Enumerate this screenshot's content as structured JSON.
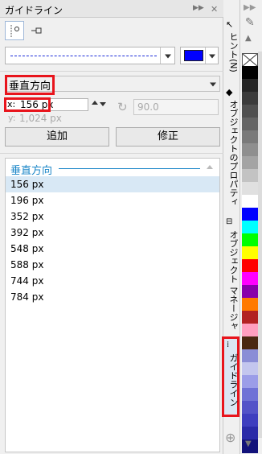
{
  "title": "ガイドライン",
  "title_help": "?",
  "color_value": "#0000ff",
  "direction_select": "垂直方向",
  "x_label": "x:",
  "x_value": "156 px",
  "y_label": "y:",
  "y_value": "1,024 px",
  "angle_value": "90.0",
  "add_button": "追加",
  "modify_button": "修正",
  "list_header": "垂直方向",
  "guides": [
    "156  px",
    "196  px",
    "352  px",
    "392  px",
    "548  px",
    "588  px",
    "744  px",
    "784  px"
  ],
  "side_tabs": {
    "hints": "ヒント(N)",
    "object_properties": "オブジェクトのプロパティ",
    "object_manager": "オブジェクト マネージャ",
    "guidelines": "ガイドライン"
  },
  "palette_colors": [
    "#ffffff",
    "#000000",
    "#252525",
    "#3b3b3b",
    "#505050",
    "#656565",
    "#7a7a7a",
    "#8f8f8f",
    "#a4a4a4",
    "#c3c3c3",
    "#e0e0e0",
    "#ffffff",
    "#0000ff",
    "#00ffff",
    "#00ff00",
    "#ffff00",
    "#ff0000",
    "#ff00ff",
    "#8800aa",
    "#ff7a00",
    "#b22222",
    "#ff9fbf",
    "#4a2810",
    "#8a8dd6",
    "#c3c6ee",
    "#9b9de8",
    "#6f72d6",
    "#5353c8",
    "#3e3ebf",
    "#2a2aa8",
    "#12127a"
  ]
}
